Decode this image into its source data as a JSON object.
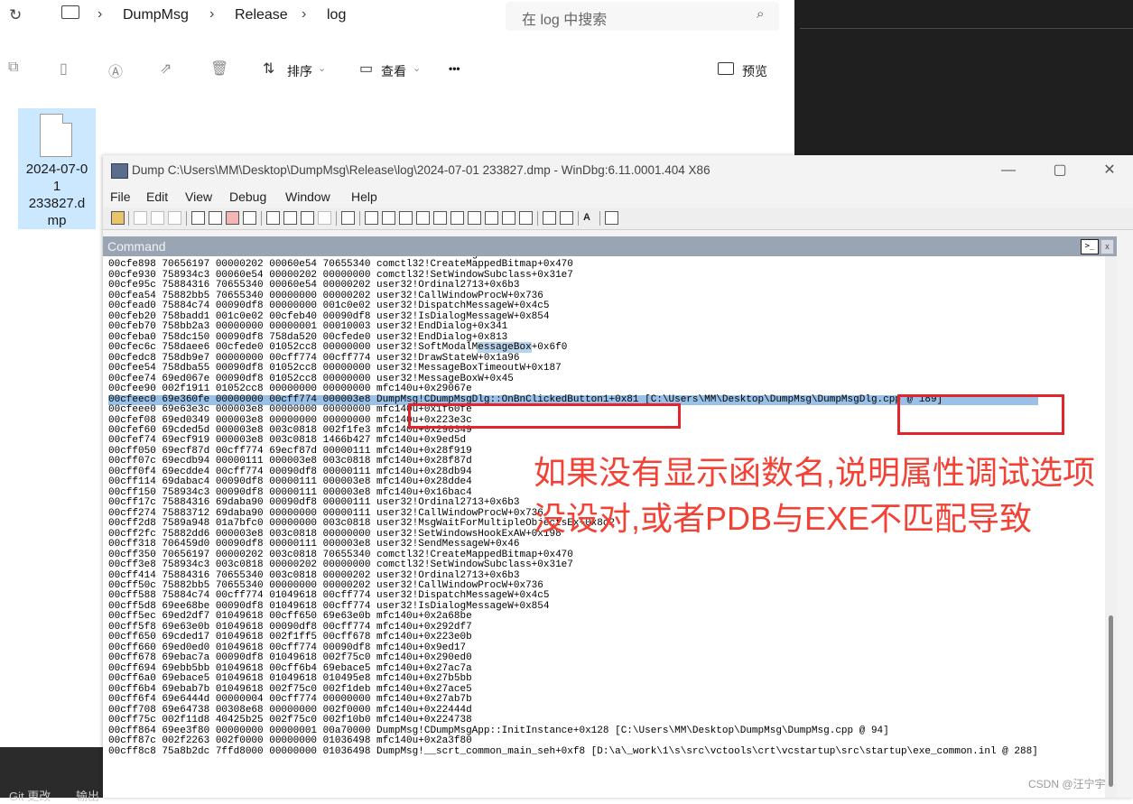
{
  "explorer": {
    "breadcrumb": [
      "DumpMsg",
      "Release",
      "log"
    ],
    "search_placeholder": "在 log 中搜索",
    "sort_label": "排序",
    "view_label": "查看",
    "more_label": "•••",
    "preview_label": "预览",
    "file_name": "2024-07-0\n1\n233827.d\nmp",
    "bottom_left": [
      "Git 更改",
      "输出"
    ]
  },
  "window": {
    "title": "Dump C:\\Users\\MM\\Desktop\\DumpMsg\\Release\\log\\2024-07-01 233827.dmp - WinDbg:6.11.0001.404 X86",
    "menu": [
      "File",
      "Edit",
      "View",
      "Debug",
      "Window",
      "Help"
    ],
    "toolbar_text": [
      "A"
    ]
  },
  "command": {
    "title": "Command",
    "prompt_icon": ">_",
    "close_icon": "x",
    "lines": [
      "00cfe860 706459d0 001c0e02 00000111 00000002 user32!SendMessageW+0x46",
      "00cfe898 70656197 00000202 00060e54 70655340 comctl32!CreateMappedBitmap+0x470",
      "00cfe930 758934c3 00060e54 00000202 00000000 comctl32!SetWindowSubclass+0x31e7",
      "00cfe95c 75884316 70655340 00060e54 00000202 user32!Ordinal2713+0x6b3",
      "00cfea54 75882bb5 70655340 00000000 00000202 user32!CallWindowProcW+0x736",
      "00cfead0 75884c74 00090df8 00000000 001c0e02 user32!DispatchMessageW+0x4c5",
      "00cfeb20 758badd1 001c0e02 00cfeb40 00090df8 user32!IsDialogMessageW+0x854",
      "00cfeb70 758bb2a3 00000000 00000001 00010003 user32!EndDialog+0x341",
      "00cfeba0 758dc150 00090df8 758da520 00cfede0 user32!EndDialog+0x813",
      "00cfec6c 758daee6 00cfede0 01052cc8 00000000 user32!SoftModalMessageBox+0x6f0",
      "00cfedc8 758db9e7 00000000 00cff774 00cff774 user32!DrawStateW+0x1a96",
      "00cfee54 758dba55 00090df8 01052cc8 00000000 user32!MessageBoxTimeoutW+0x187",
      "00cfee74 69ed067e 00090df8 01052cc8 00000000 user32!MessageBoxW+0x45",
      "00cfee90 002f1911 01052cc8 00000000 00000000 mfc140u+0x29067e",
      "00cfeec0 69e360fe 00000000 00cff774 000003e8 DumpMsg!CDumpMsgDlg::OnBnClickedButton1+0x81 [C:\\Users\\MM\\Desktop\\DumpMsg\\DumpMsgDlg.cpp @ 189]",
      "00cfeee0 69e63e3c 000003e8 00000000 00000000 mfc140u+0x1f60fe",
      "00cfef08 69ed0349 000003e8 00000000 00000000 mfc140u+0x223e3c",
      "00cfef60 69cded5d 000003e8 003c0818 002f1fe3 mfc140u+0x290349",
      "00cfef74 69ecf919 000003e8 003c0818 1466b427 mfc140u+0x9ed5d",
      "00cff050 69ecf87d 00cff774 69ecf87d 00000111 mfc140u+0x28f919",
      "00cff07c 69ecdb94 00000111 000003e8 003c0818 mfc140u+0x28f87d",
      "00cff0f4 69ecdde4 00cff774 00090df8 00000111 mfc140u+0x28db94",
      "00cff114 69dabac4 00090df8 00000111 000003e8 mfc140u+0x28dde4",
      "00cff150 758934c3 00090df8 00000111 000003e8 mfc140u+0x16bac4",
      "00cff17c 75884316 69daba90 00090df8 00000111 user32!Ordinal2713+0x6b3",
      "00cff274 75883712 69daba90 00000000 00000111 user32!CallWindowProcW+0x736",
      "00cff2d8 7589a948 01a7bfc0 00000000 003c0818 user32!MsgWaitForMultipleObjectsEx+0x8d2",
      "00cff2fc 75882dd6 000003e8 003c0818 00000000 user32!SetWindowsHookExAW+0x198",
      "00cff318 706459d0 00090df8 00000111 000003e8 user32!SendMessageW+0x46",
      "00cff350 70656197 00000202 003c0818 70655340 comctl32!CreateMappedBitmap+0x470",
      "00cff3e8 758934c3 003c0818 00000202 00000000 comctl32!SetWindowSubclass+0x31e7",
      "00cff414 75884316 70655340 003c0818 00000202 user32!Ordinal2713+0x6b3",
      "00cff50c 75882bb5 70655340 00000000 00000202 user32!CallWindowProcW+0x736",
      "00cff588 75884c74 00cff774 01049618 00cff774 user32!DispatchMessageW+0x4c5",
      "00cff5d8 69ee68be 00090df8 01049618 00cff774 user32!IsDialogMessageW+0x854",
      "00cff5ec 69ed2df7 01049618 00cff650 69e63e0b mfc140u+0x2a68be",
      "00cff5f8 69e63e0b 01049618 00090df8 00cff774 mfc140u+0x292df7",
      "00cff650 69cded17 01049618 002f1ff5 00cff678 mfc140u+0x223e0b",
      "00cff660 69ed0ed0 01049618 00cff774 00090df8 mfc140u+0x9ed17",
      "00cff678 69ebac7a 00090df8 01049618 002f75c0 mfc140u+0x290ed0",
      "00cff694 69ebb5bb 01049618 00cff6b4 69ebace5 mfc140u+0x27ac7a",
      "00cff6a0 69ebace5 01049618 01049618 010495e8 mfc140u+0x27b5bb",
      "00cff6b4 69ebab7b 01049618 002f75c0 002f1deb mfc140u+0x27ace5",
      "00cff6f4 69e6444d 00000004 00cff774 00000000 mfc140u+0x27ab7b",
      "00cff708 69e64738 00308e68 00000000 002f0000 mfc140u+0x22444d",
      "00cff75c 002f11d8 40425b25 002f75c0 002f10b0 mfc140u+0x224738",
      "00cff864 69ee3f80 00000000 00000001 00a70000 DumpMsg!CDumpMsgApp::InitInstance+0x128 [C:\\Users\\MM\\Desktop\\DumpMsg\\DumpMsg.cpp @ 94]",
      "00cff87c 002f2263 002f0000 00000000 01036498 mfc140u+0x2a3f80",
      "00cff8c8 75a8b2dc 7ffd8000 00000000 01036498 DumpMsg!__scrt_common_main_seh+0xf8 [D:\\a\\_work\\1\\s\\src\\vctools\\crt\\vcstartup\\src\\startup\\exe_common.inl @ 288]"
    ]
  },
  "annotation": {
    "line1": "如果没有显示函数名,说明属性调试选项",
    "line2": "没设对,或者PDB与EXE不匹配导致"
  },
  "watermark": "CSDN @汪宁宇",
  "colors": {
    "annotation_red": "#f24236",
    "box_red": "#e3242b",
    "selection_blue": "#99c1e8",
    "command_header": "#9aa5b4"
  }
}
